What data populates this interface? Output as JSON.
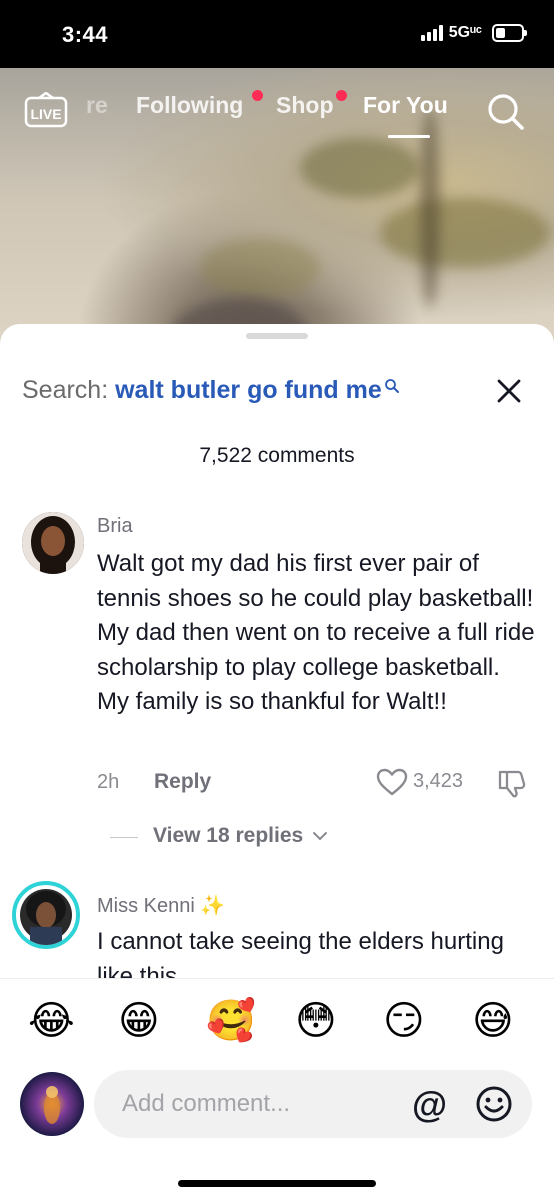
{
  "status": {
    "time": "3:44",
    "network": "5Gᵘᶜ",
    "battery_level": 0.45
  },
  "nav": {
    "live_label": "LIVE",
    "partial_item": "re",
    "items": [
      {
        "label": "Following",
        "has_dot": true
      },
      {
        "label": "Shop",
        "has_dot": true
      },
      {
        "label": "For You",
        "active": true
      }
    ],
    "search_icon": "search-icon",
    "dot_color": "#ff2d55"
  },
  "sheet": {
    "search_prefix": "Search: ",
    "search_query": "walt butler go fund me",
    "close_icon": "close-icon",
    "comment_count": "7,522 comments"
  },
  "comments": [
    {
      "name": "Bria",
      "text": "Walt got my dad his first ever pair of tennis shoes so he could play basketball! My dad then went on to receive a full ride scholarship to play college basketball. My family is so thankful for Walt!!",
      "time": "2h",
      "reply_label": "Reply",
      "likes": "3,423",
      "view_replies": "View 18 replies"
    },
    {
      "name": "Miss Kenni ✨",
      "text": "I cannot take seeing the elders hurting like this",
      "has_story_ring": true
    }
  ],
  "emojis": [
    "😂",
    "😁",
    "🥰",
    "😳",
    "😏",
    "😅"
  ],
  "composer": {
    "placeholder": "Add comment...",
    "at_label": "@",
    "emoji_icon": "smile-icon"
  },
  "accent_colors": {
    "query": "#2a5ab8",
    "ring": "#2ed3d7"
  }
}
